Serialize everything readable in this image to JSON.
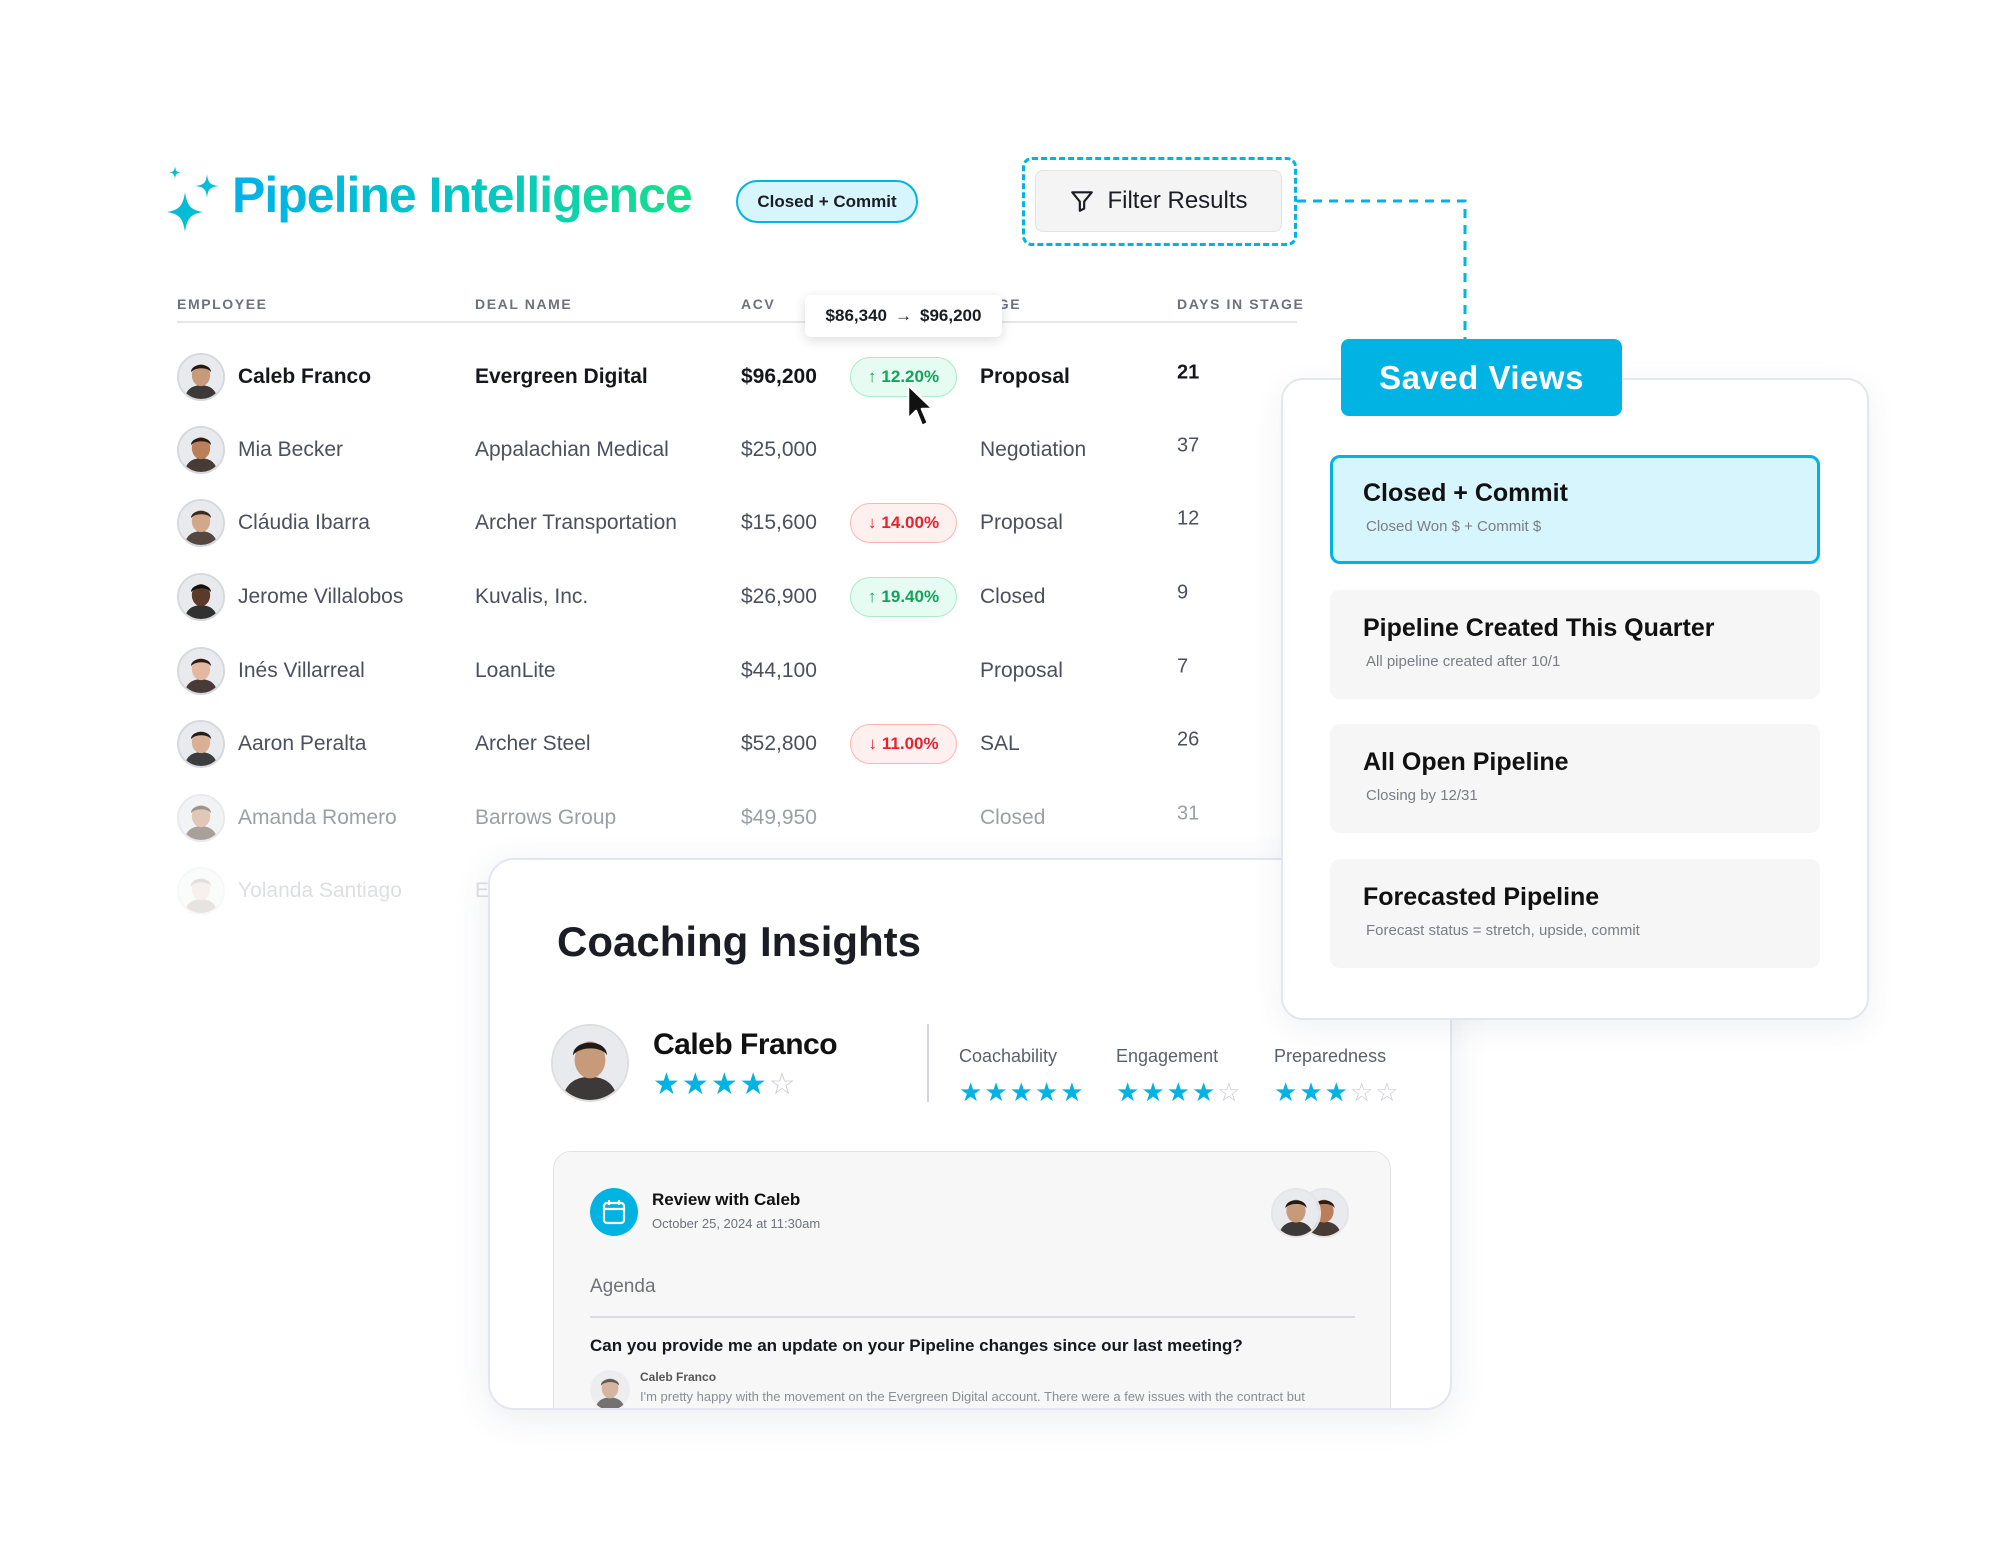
{
  "header": {
    "title": "Pipeline Intelligence",
    "active_view_badge": "Closed + Commit",
    "filter_button": "Filter Results",
    "accent_color": "#00b3e3"
  },
  "table": {
    "columns": [
      "EMPLOYEE",
      "DEAL NAME",
      "ACV",
      "STAGE",
      "DAYS IN STAGE"
    ],
    "tooltip": {
      "from": "$86,340",
      "to": "$96,200"
    },
    "rows": [
      {
        "employee": "Caleb Franco",
        "deal": "Evergreen Digital",
        "acv": "$96,200",
        "change": {
          "direction": "up",
          "value": "12.20%"
        },
        "stage": "Proposal",
        "days": "21",
        "style": "bold",
        "skin": "#c79a7a",
        "hair": "#1e1a18"
      },
      {
        "employee": "Mia Becker",
        "deal": "Appalachian Medical",
        "acv": "$25,000",
        "change": null,
        "stage": "Negotiation",
        "days": "37",
        "style": "normal",
        "skin": "#b97f5a",
        "hair": "#2a1c14"
      },
      {
        "employee": "Cláudia Ibarra",
        "deal": "Archer Transportation",
        "acv": "$15,600",
        "change": {
          "direction": "down",
          "value": "14.00%"
        },
        "stage": "Proposal",
        "days": "12",
        "style": "normal",
        "skin": "#d3a88a",
        "hair": "#3a2a20"
      },
      {
        "employee": "Jerome Villalobos",
        "deal": "Kuvalis, Inc.",
        "acv": "$26,900",
        "change": {
          "direction": "up",
          "value": "19.40%"
        },
        "stage": "Closed",
        "days": "9",
        "style": "normal",
        "skin": "#5a3a28",
        "hair": "#111"
      },
      {
        "employee": "Inés Villarreal",
        "deal": "LoanLite",
        "acv": "$44,100",
        "change": null,
        "stage": "Proposal",
        "days": "7",
        "style": "normal",
        "skin": "#e2b9a0",
        "hair": "#2b1b16"
      },
      {
        "employee": "Aaron Peralta",
        "deal": "Archer Steel",
        "acv": "$52,800",
        "change": {
          "direction": "down",
          "value": "11.00%"
        },
        "stage": "SAL",
        "days": "26",
        "style": "normal",
        "skin": "#d8b096",
        "hair": "#1e1e1e"
      },
      {
        "employee": "Amanda Romero",
        "deal": "Barrows Group",
        "acv": "$49,950",
        "change": null,
        "stage": "Closed",
        "days": "31",
        "style": "faded",
        "skin": "#c89a7e",
        "hair": "#4a3a2e"
      },
      {
        "employee": "Yolanda Santiago",
        "deal": "E",
        "acv": "",
        "change": null,
        "stage": "",
        "days": "",
        "style": "ghost",
        "skin": "#d6b09a",
        "hair": "#6a5040"
      }
    ]
  },
  "saved_views": {
    "title": "Saved Views",
    "items": [
      {
        "name": "Closed + Commit",
        "description": "Closed Won $  + Commit $",
        "active": true
      },
      {
        "name": "Pipeline Created This Quarter",
        "description": "All pipeline created after 10/1",
        "active": false
      },
      {
        "name": "All Open Pipeline",
        "description": "Closing by 12/31",
        "active": false
      },
      {
        "name": "Forecasted Pipeline",
        "description": "Forecast status  = stretch, upside, commit",
        "active": false
      }
    ]
  },
  "coaching": {
    "title": "Coaching Insights",
    "employee": "Caleb Franco",
    "overall_rating": 4,
    "max_rating": 5,
    "metrics": [
      {
        "label": "Coachability",
        "rating": 5
      },
      {
        "label": "Engagement",
        "rating": 4
      },
      {
        "label": "Preparedness",
        "rating": 3
      }
    ],
    "review": {
      "title": "Review with Caleb",
      "date": "October 25, 2024 at 11:30am",
      "agenda_label": "Agenda",
      "question": "Can you provide me an update on your Pipeline changes since our last meeting?",
      "reply_author": "Caleb Franco",
      "reply_text": "I'm pretty happy with the movement on the Evergreen Digital account. There were a few issues with the contract but"
    }
  }
}
